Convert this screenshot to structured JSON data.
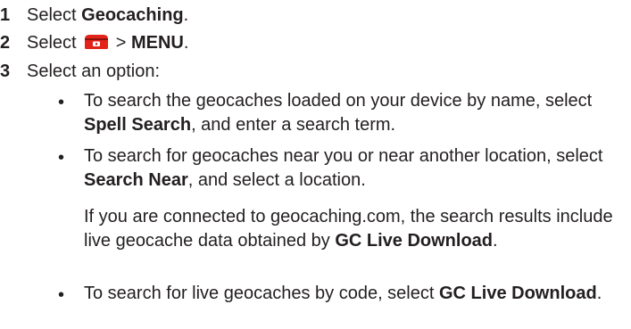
{
  "steps": [
    {
      "number": "1",
      "pre": "Select ",
      "bold": "Geocaching",
      "post": "."
    },
    {
      "number": "2",
      "pre": "Select ",
      "icon": "geocache-chest-icon",
      "mid": " > ",
      "bold": "MENU",
      "post": "."
    },
    {
      "number": "3",
      "text": "Select an option:"
    }
  ],
  "options": [
    {
      "bullet": "•",
      "pre": "To search the geocaches loaded on your device by name, select ",
      "bold": "Spell Search",
      "post": ", and enter a search term."
    },
    {
      "bullet": "•",
      "pre": "To search for geocaches near you or near another location, select ",
      "bold": "Search Near",
      "post": ", and select a location.",
      "note": {
        "pre": "If you are connected to geocaching.com, the search results include live geocache data obtained by ",
        "bold": "GC Live Download",
        "post": "."
      }
    },
    {
      "bullet": "•",
      "pre": "To search for live geocaches by code, select ",
      "bold": "GC Live Download",
      "post": "."
    }
  ],
  "colors": {
    "text": "#231f20",
    "icon_fill": "#e2231a"
  }
}
